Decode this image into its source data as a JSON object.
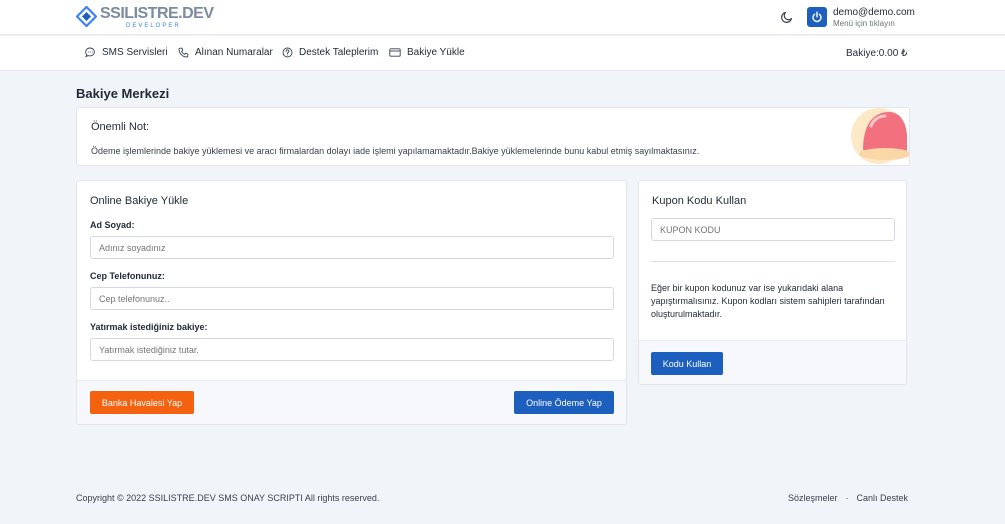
{
  "brand": {
    "title": "SSILISTRE.DEV",
    "subtitle": "DEVELOPER",
    "accent": "#1d5fbf"
  },
  "user": {
    "email": "demo@demo.com",
    "hint": "Menü için tıklayın",
    "icon": "power-icon"
  },
  "nav": {
    "items": [
      {
        "label": "SMS Servisleri",
        "icon": "message-icon"
      },
      {
        "label": "Alınan Numaralar",
        "icon": "phone-icon"
      },
      {
        "label": "Destek Taleplerim",
        "icon": "help-icon"
      },
      {
        "label": "Bakiye Yükle",
        "icon": "card-icon"
      }
    ],
    "balance": "Bakiye:0.00 ₺"
  },
  "page": {
    "title": "Bakiye Merkezi"
  },
  "notice": {
    "title": "Önemli Not:",
    "text": "Ödeme işlemlerinde bakiye yüklemesi ve aracı firmalardan dolayı iade işlemi yapılamamaktadır.Bakiye yüklemelerinde bunu kabul etmiş sayılmaktasınız."
  },
  "online_form": {
    "title": "Online Bakiye Yükle",
    "name_label": "Ad Soyad:",
    "name_placeholder": "Adınız soyadınız",
    "phone_label": "Cep Telefonunuz:",
    "phone_placeholder": "Cep telefonunuz..",
    "amount_label": "Yatırmak istediğiniz bakiye:",
    "amount_placeholder": "Yatırmak istediğiniz tutar.",
    "bank_button": "Banka Havalesi Yap",
    "online_button": "Online Ödeme Yap",
    "bank_color": "#f5620f"
  },
  "coupon": {
    "title": "Kupon Kodu Kullan",
    "placeholder": "KUPON KODU",
    "info": "Eğer bir kupon kodunuz var ise yukarıdaki alana yapıştırmalısınız. Kupon kodları sistem sahipleri tarafından oluşturulmaktadır.",
    "button": "Kodu Kullan"
  },
  "footer": {
    "copyright": "Copyright © 2022 SSILISTRE.DEV SMS ONAY SCRIPTI All rights reserved.",
    "links": [
      "Sözleşmeler",
      "Canlı Destek"
    ],
    "separator": "·"
  }
}
